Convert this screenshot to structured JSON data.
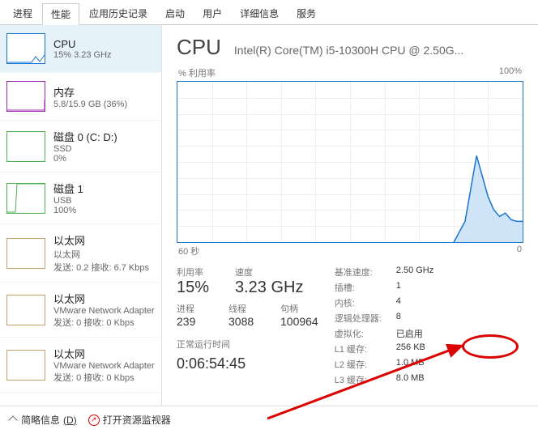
{
  "tabs": [
    "进程",
    "性能",
    "应用历史记录",
    "启动",
    "用户",
    "详细信息",
    "服务"
  ],
  "activeTab": 1,
  "sidebar": [
    {
      "title": "CPU",
      "sub": "15% 3.23 GHz",
      "kind": "cpu"
    },
    {
      "title": "内存",
      "sub": "5.8/15.9 GB (36%)",
      "kind": "mem"
    },
    {
      "title": "磁盘 0 (C: D:)",
      "sub": "SSD\n0%",
      "kind": "disk"
    },
    {
      "title": "磁盘 1",
      "sub": "USB\n100%",
      "kind": "disk"
    },
    {
      "title": "以太网",
      "sub": "以太网\n发送: 0.2 接收: 6.7 Kbps",
      "kind": "eth"
    },
    {
      "title": "以太网",
      "sub": "VMware Network Adapter\n发送: 0 接收: 0 Kbps",
      "kind": "eth"
    },
    {
      "title": "以太网",
      "sub": "VMware Network Adapter\n发送: 0 接收: 0 Kbps",
      "kind": "eth"
    }
  ],
  "detail": {
    "title": "CPU",
    "model": "Intel(R) Core(TM) i5-10300H CPU @ 2.50G...",
    "chart": {
      "ylabel": "% 利用率",
      "ymax": "100%",
      "xl": "60 秒",
      "xr": "0"
    },
    "big": [
      {
        "label": "利用率",
        "value": "15%"
      },
      {
        "label": "速度",
        "value": "3.23 GHz"
      }
    ],
    "small": [
      {
        "label": "进程",
        "value": "239"
      },
      {
        "label": "线程",
        "value": "3088"
      },
      {
        "label": "句柄",
        "value": "100964"
      }
    ],
    "uptime": {
      "label": "正常运行时间",
      "value": "0:06:54:45"
    },
    "right": [
      [
        "基准速度:",
        "2.50 GHz"
      ],
      [
        "插槽:",
        "1"
      ],
      [
        "内核:",
        "4"
      ],
      [
        "逻辑处理器:",
        "8"
      ],
      [
        "虚拟化:",
        "已启用"
      ],
      [
        "L1 缓存:",
        "256 KB"
      ],
      [
        "L2 缓存:",
        "1.0 MB"
      ],
      [
        "L3 缓存:",
        "8.0 MB"
      ]
    ]
  },
  "footer": {
    "brief": "简略信息",
    "briefKey": "(D)",
    "resmon": "打开资源监视器"
  },
  "chart_data": {
    "type": "line",
    "title": "% 利用率",
    "xlabel": "60 秒 → 0",
    "ylabel": "% 利用率",
    "ylim": [
      0,
      100
    ],
    "x_seconds": [
      60,
      55,
      50,
      45,
      40,
      35,
      30,
      25,
      20,
      15,
      12,
      10,
      8,
      6,
      5,
      4,
      3,
      2,
      1,
      0
    ],
    "values": [
      0,
      0,
      0,
      0,
      0,
      0,
      0,
      0,
      0,
      0,
      2,
      15,
      55,
      30,
      22,
      18,
      20,
      16,
      15,
      15
    ]
  }
}
